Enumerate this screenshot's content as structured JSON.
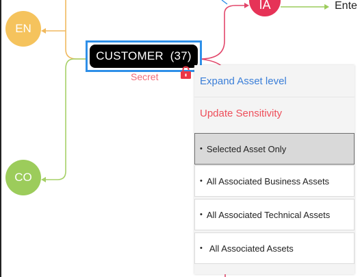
{
  "graph": {
    "nodes": {
      "en": {
        "label": "EN",
        "color": "#f5c35d"
      },
      "co": {
        "label": "CO",
        "color": "#9ccc5b"
      },
      "ia": {
        "label": "IA",
        "color": "#e63357"
      }
    },
    "edge_label": "Ente",
    "selected_node": {
      "label": "CUSTOMER  (37)",
      "sensitivity": "Secret",
      "icon": "lock-icon"
    }
  },
  "context_menu": {
    "expand_label": "Expand Asset level",
    "update_label": "Update Sensitivity",
    "options": [
      {
        "label": "Selected Asset Only",
        "selected": true
      },
      {
        "label": "All Associated Business Assets",
        "selected": false
      },
      {
        "label": "All Associated Technical Assets",
        "selected": false
      },
      {
        "label": "All Associated Assets",
        "selected": false
      }
    ],
    "bullet": "•"
  }
}
